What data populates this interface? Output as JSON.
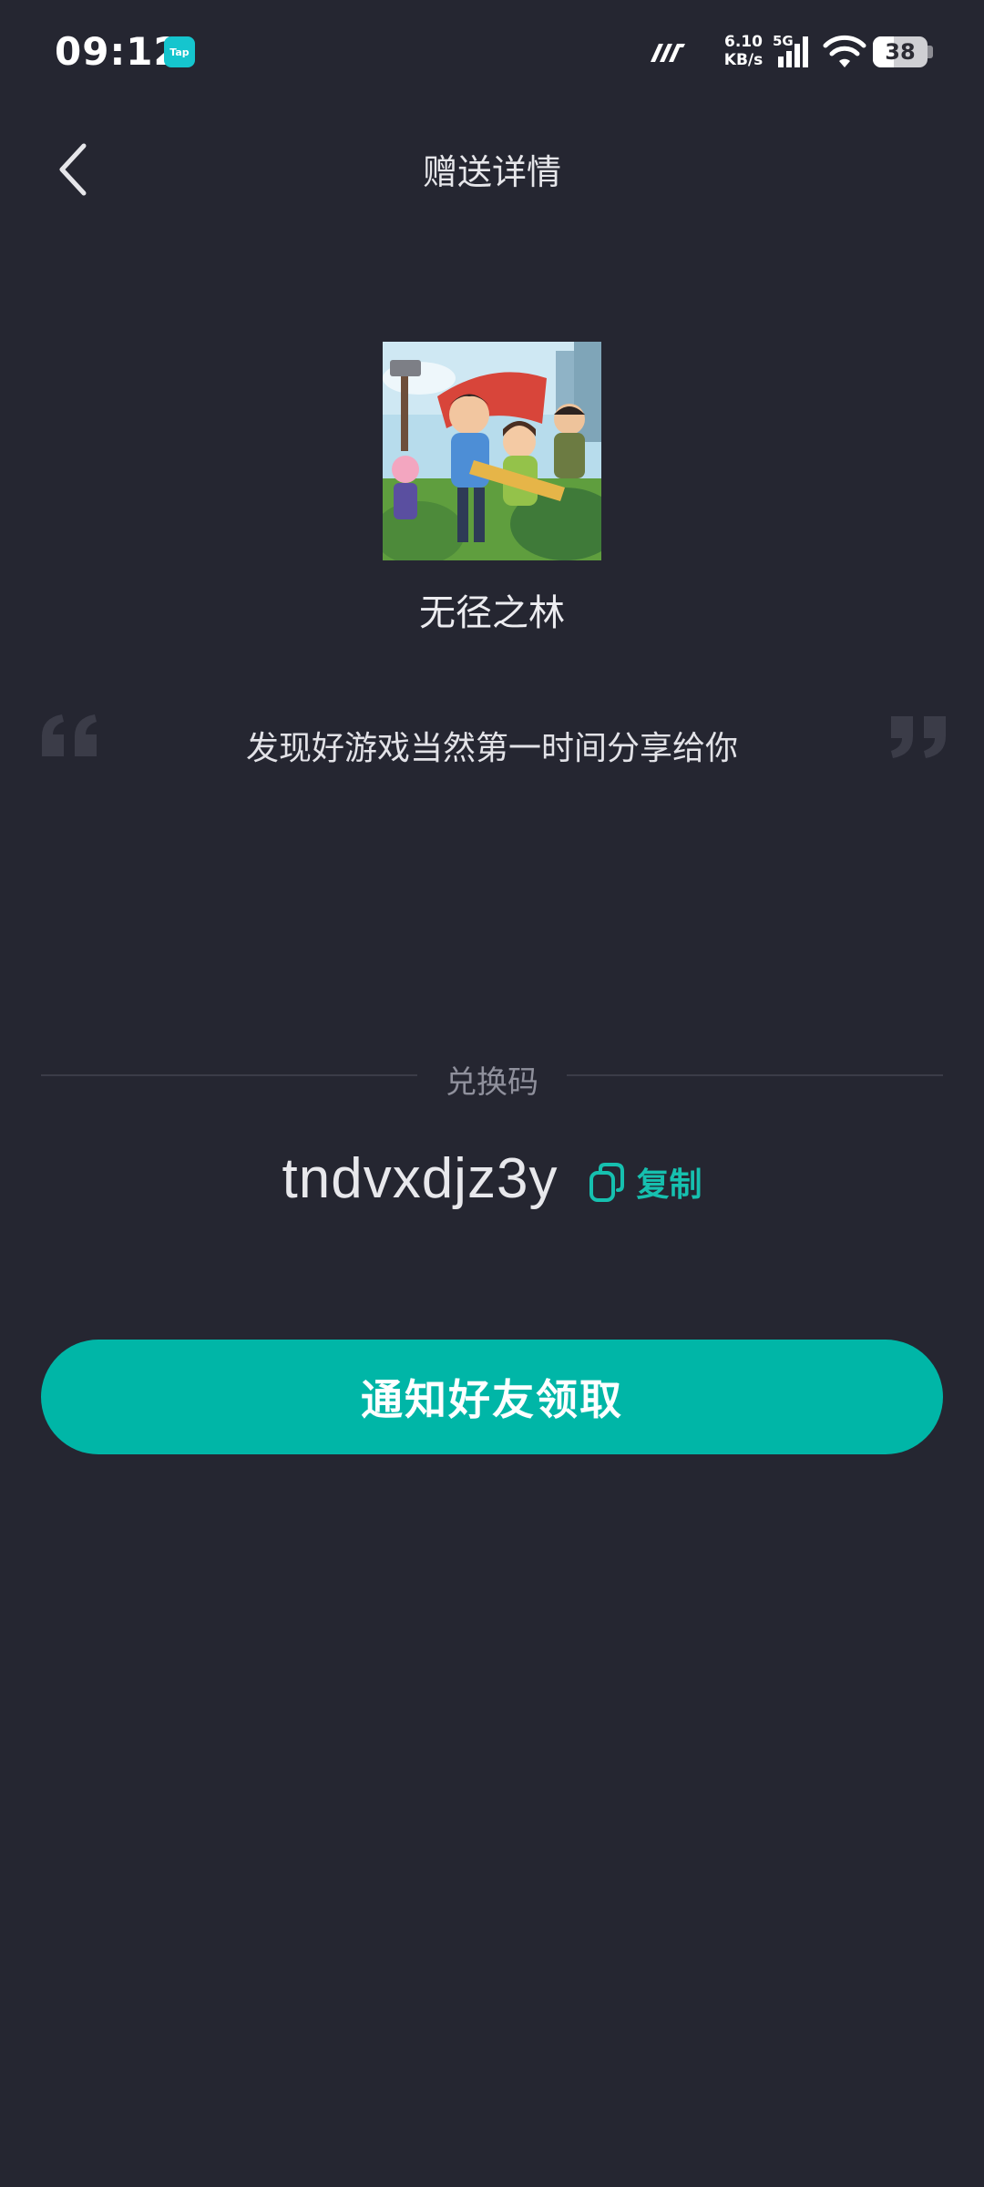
{
  "status_bar": {
    "time": "09:12",
    "app_badge": "Tap",
    "net_speed_value": "6.10",
    "net_speed_unit": "KB/s",
    "network_type": "5G",
    "battery_level": "38",
    "battery_fraction": 0.38
  },
  "header": {
    "title": "赠送详情"
  },
  "game": {
    "name": "无径之林"
  },
  "message": {
    "text": "发现好游戏当然第一时间分享给你"
  },
  "redeem": {
    "label": "兑换码",
    "code": "tndvxdjz3y",
    "copy_label": "复制"
  },
  "actions": {
    "notify_label": "通知好友领取"
  },
  "colors": {
    "background": "#252631",
    "accent": "#00b6a7",
    "copy_accent": "#16c0af"
  }
}
